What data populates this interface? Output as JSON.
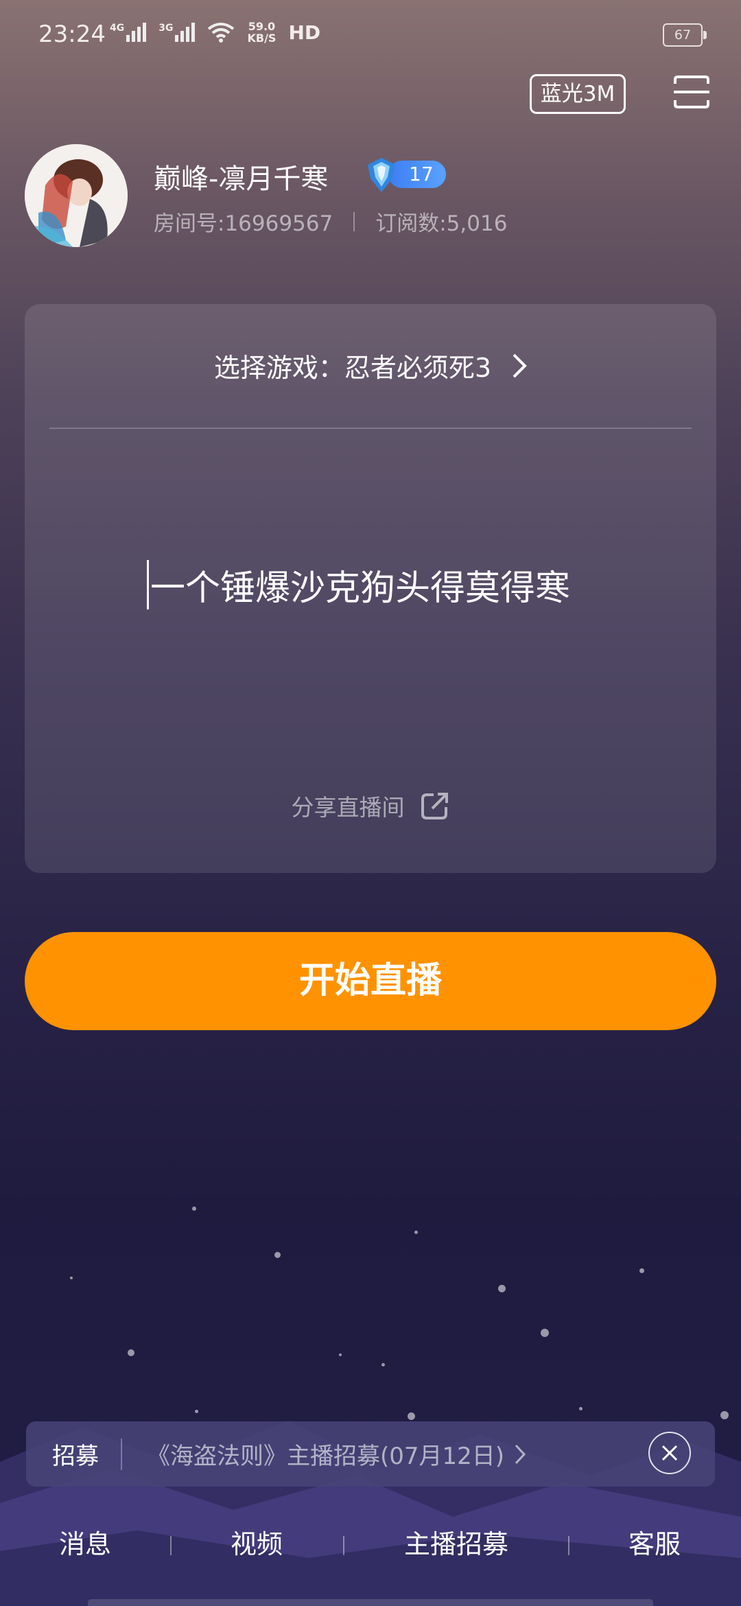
{
  "status_bar": {
    "time": "23:24",
    "net_4g": "4G",
    "net_3g": "3G",
    "speed_value": "59.0",
    "speed_unit": "KB/S",
    "hd": "HD",
    "battery": "67"
  },
  "header": {
    "quality_label": "蓝光3M",
    "menu_icon": "menu-lines-icon"
  },
  "profile": {
    "username": "巅峰-凛月千寒",
    "level": "17",
    "room_number": "房间号:16969567",
    "subscribers": "订阅数:5,016"
  },
  "card": {
    "game_select_label": "选择游戏：忍者必须死3",
    "stream_title": "一个锤爆沙克狗头得莫得寒",
    "share_label": "分享直播间"
  },
  "start_button": "开始直播",
  "recruit": {
    "label": "招募",
    "text": "《海盗法则》主播招募(07月12日)"
  },
  "bottom_nav": [
    "消息",
    "视频",
    "主播招募",
    "客服"
  ],
  "colors": {
    "accent": "#ff9200",
    "level_badge": "#4a8ef8"
  }
}
